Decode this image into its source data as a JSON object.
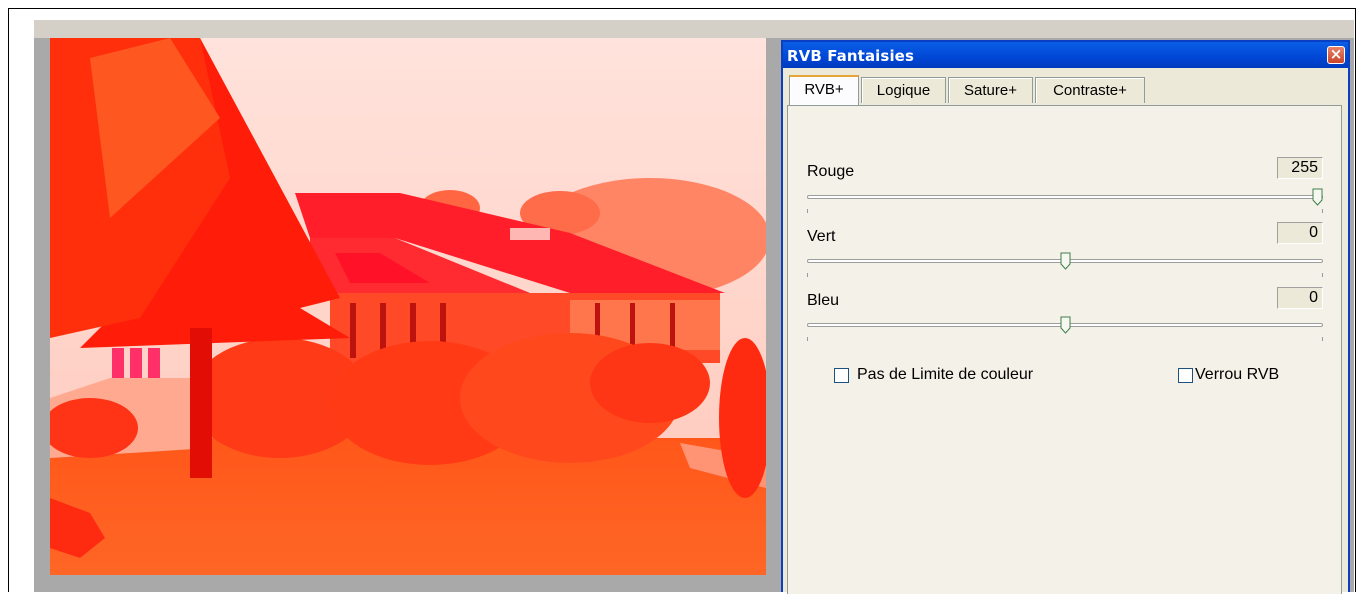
{
  "dialog": {
    "title": "RVB Fantaisies",
    "tabs": [
      {
        "label": "RVB+",
        "active": true
      },
      {
        "label": "Logique",
        "active": false
      },
      {
        "label": "Sature+",
        "active": false
      },
      {
        "label": "Contraste+",
        "active": false
      }
    ],
    "sliders": [
      {
        "label": "Rouge",
        "value": "255",
        "level": 1.0
      },
      {
        "label": "Vert",
        "value": "0",
        "level": 0.5
      },
      {
        "label": "Bleu",
        "value": "0",
        "level": 0.5
      }
    ],
    "checkboxes": [
      {
        "label": "Pas de Limite de couleur",
        "checked": false
      },
      {
        "label": "Verrou RVB",
        "checked": false
      }
    ]
  },
  "colors": {
    "title_bar": "#0054e3",
    "photo_tint": "#ff3a10"
  },
  "icons": {
    "close": "close-icon"
  }
}
